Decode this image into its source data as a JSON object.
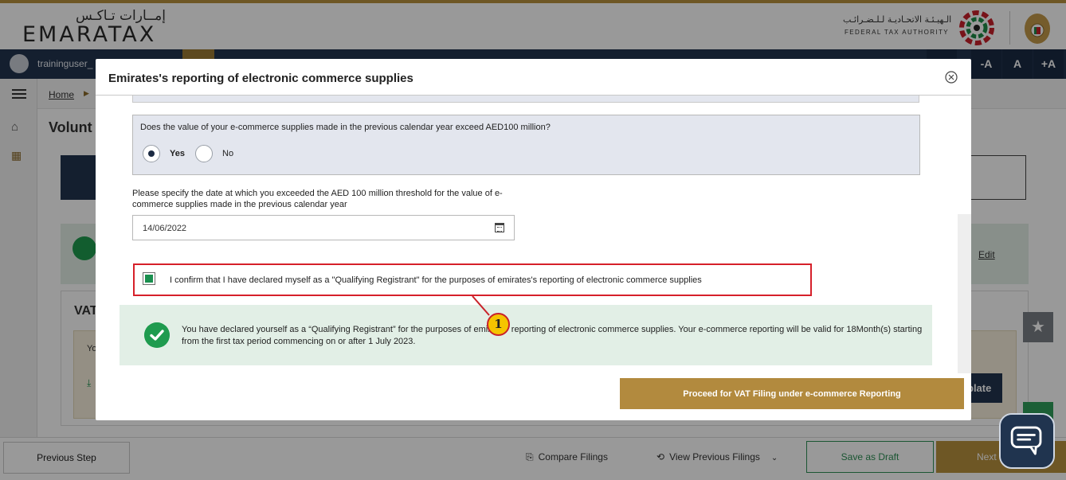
{
  "header": {
    "logo_ar": "إمــارات تـاكـس",
    "logo_en": "EMARATAX",
    "fta_ar": "الـهيـئـة الاتحـاديـة لـلـضـرائـب",
    "fta_en": "FEDERAL TAX AUTHORITY"
  },
  "navbar": {
    "username": "traininguser_",
    "font_controls": [
      "-A",
      "A",
      "+A"
    ]
  },
  "breadcrumb": {
    "home": "Home"
  },
  "page": {
    "title": "Volunt",
    "edit_label": "Edit",
    "vat_label": "VAT",
    "tan_prefix": "Yo",
    "download_label": "plate"
  },
  "modal": {
    "title": "Emirates's reporting of electronic commerce supplies",
    "question": "Does the value of your e-commerce supplies made in the previous calendar year exceed AED100 million?",
    "yes_label": "Yes",
    "no_label": "No",
    "selected": "Yes",
    "date_label": "Please specify the date at which you exceeded the AED 100 million threshold for the value of e-commerce supplies made in the previous calendar year",
    "date_value": "14/06/2022",
    "confirm_text": "I confirm that I have declared myself as a \"Qualifying Registrant\" for the purposes of emirates's reporting of electronic commerce supplies",
    "confirm_checked": true,
    "success_text": "You have declared yourself as a “Qualifying Registrant” for the purposes of emirates' reporting of electronic commerce supplies. Your e-commerce reporting will be valid for 18Month(s) starting from the first tax period commencing on or after 1 July 2023.",
    "proceed_label": "Proceed for VAT Filing under e-commerce Reporting"
  },
  "bottombar": {
    "previous_label": "Previous Step",
    "compare_label": "Compare Filings",
    "view_previous_label": "View Previous Filings",
    "save_draft_label": "Save as Draft",
    "next_label": "Next"
  },
  "annotation": {
    "number": "1"
  },
  "colors": {
    "navy": "#22354f",
    "gold": "#b8913e",
    "green": "#1f9b4f",
    "highlight_red": "#d6202a",
    "annotation_yellow": "#f5c400"
  }
}
